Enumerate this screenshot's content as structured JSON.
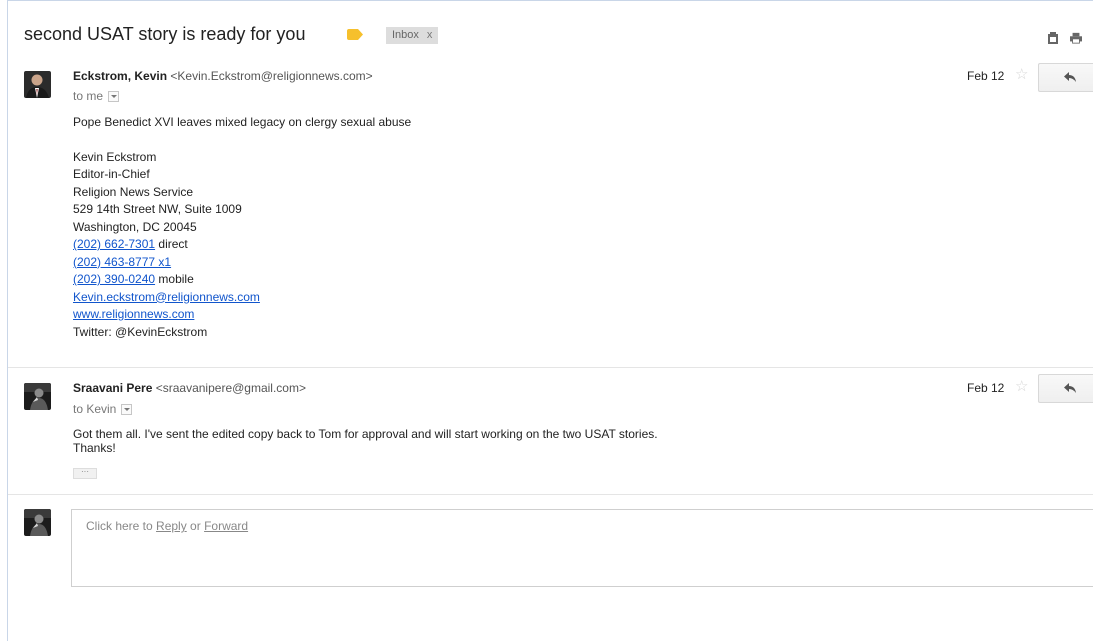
{
  "header": {
    "subject": "second USAT story is ready for you",
    "label": "Inbox",
    "label_close": "x",
    "label_color": "#f6c02c"
  },
  "messages": [
    {
      "sender_name": "Eckstrom, Kevin",
      "sender_email": "<Kevin.Eckstrom@religionnews.com>",
      "to": "to me",
      "date": "Feb 12",
      "body": {
        "subject_line": "Pope Benedict XVI leaves mixed legacy on clergy sexual abuse",
        "sig_name": "Kevin Eckstrom",
        "sig_title": "Editor-in-Chief",
        "sig_org": "Religion News Service",
        "sig_addr1": "529 14th Street NW, Suite 1009",
        "sig_addr2": "Washington, DC  20045",
        "phone_direct": "(202) 662-7301",
        "phone_direct_suffix": " direct",
        "phone_x1": "(202) 463-8777 x1",
        "phone_mobile": "(202) 390-0240",
        "phone_mobile_suffix": " mobile",
        "email_link": "Kevin.eckstrom@religionnews.com",
        "web_link": "www.religionnews.com",
        "twitter": "Twitter: @KevinEckstrom"
      }
    },
    {
      "sender_name": "Sraavani Pere",
      "sender_email": "<sraavanipere@gmail.com>",
      "to": "to Kevin",
      "date": "Feb 12",
      "body": {
        "line1": "Got them all. I've sent the edited copy back to Tom for approval and will start working on the two USAT stories.",
        "line2": "Thanks!"
      },
      "trimmed": "···"
    }
  ],
  "reply": {
    "prefix": "Click here to ",
    "reply_link": "Reply",
    "or": " or ",
    "forward_link": "Forward"
  },
  "colors": {
    "link": "#1155cc",
    "star_empty": "#d6d6d6"
  },
  "icons": {
    "label_tag": "label-tag-icon",
    "print": "print-icon",
    "new_window": "new-window-icon",
    "reply": "reply-arrow-icon",
    "star": "star-icon"
  }
}
